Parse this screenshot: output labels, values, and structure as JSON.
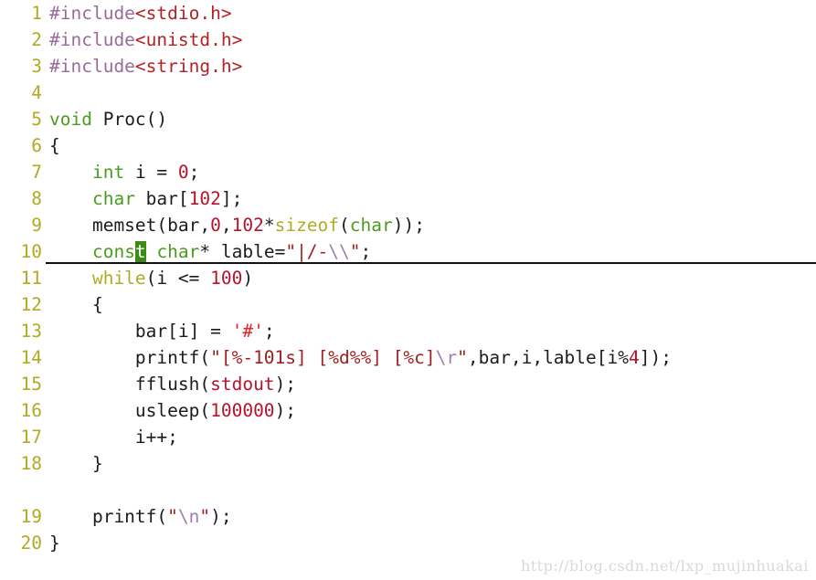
{
  "editor": {
    "language": "C",
    "background_color": "#ffffff",
    "line_height_px": 29,
    "font_size_px": 19.5,
    "active_line": 10,
    "cursor": {
      "line": 10,
      "char": "t",
      "word": "const",
      "color": "#3a8c12"
    },
    "palette": {
      "line_number": "#b0ab22",
      "preprocessor": "#9a6b9a",
      "header_name": "#b32222",
      "type_keyword": "#4a9c20",
      "control_keyword": "#b0ab22",
      "number_literal": "#b8122b",
      "string_literal": "#a02020",
      "escape_sequence": "#9b7fb0",
      "char_literal": "#e8202a",
      "plain_text": "#1c1c1c",
      "cursor_block": "#3a8c12",
      "active_line_underline": "#111111",
      "watermark": "#d9d9d9"
    }
  },
  "lines": [
    {
      "n": "1",
      "tokens": [
        {
          "t": "#include",
          "c": "pp"
        },
        {
          "t": "<stdio.h>",
          "c": "header"
        }
      ]
    },
    {
      "n": "2",
      "tokens": [
        {
          "t": "#include",
          "c": "pp"
        },
        {
          "t": "<unistd.h>",
          "c": "header"
        }
      ]
    },
    {
      "n": "3",
      "tokens": [
        {
          "t": "#include",
          "c": "pp"
        },
        {
          "t": "<string.h>",
          "c": "header"
        }
      ]
    },
    {
      "n": "4",
      "tokens": []
    },
    {
      "n": "5",
      "tokens": [
        {
          "t": "void",
          "c": "type"
        },
        {
          "t": " Proc()",
          "c": "plain"
        }
      ]
    },
    {
      "n": "6",
      "tokens": [
        {
          "t": "{",
          "c": "plain"
        }
      ]
    },
    {
      "n": "7",
      "tokens": [
        {
          "t": "    ",
          "c": "plain"
        },
        {
          "t": "int",
          "c": "type"
        },
        {
          "t": " i = ",
          "c": "plain"
        },
        {
          "t": "0",
          "c": "number"
        },
        {
          "t": ";",
          "c": "plain"
        }
      ]
    },
    {
      "n": "8",
      "tokens": [
        {
          "t": "    ",
          "c": "plain"
        },
        {
          "t": "char",
          "c": "type"
        },
        {
          "t": " bar[",
          "c": "plain"
        },
        {
          "t": "102",
          "c": "number"
        },
        {
          "t": "];",
          "c": "plain"
        }
      ]
    },
    {
      "n": "9",
      "tokens": [
        {
          "t": "    memset(bar,",
          "c": "plain"
        },
        {
          "t": "0",
          "c": "number"
        },
        {
          "t": ",",
          "c": "plain"
        },
        {
          "t": "102",
          "c": "number"
        },
        {
          "t": "*",
          "c": "plain"
        },
        {
          "t": "sizeof",
          "c": "keyword"
        },
        {
          "t": "(",
          "c": "plain"
        },
        {
          "t": "char",
          "c": "type"
        },
        {
          "t": "));",
          "c": "plain"
        }
      ]
    },
    {
      "n": "10",
      "active": true,
      "tokens": [
        {
          "t": "    ",
          "c": "plain"
        },
        {
          "t": "cons",
          "c": "type"
        },
        {
          "t": "t",
          "c": "type",
          "cursor": true
        },
        {
          "t": " ",
          "c": "plain"
        },
        {
          "t": "char",
          "c": "type"
        },
        {
          "t": "* lable=",
          "c": "plain"
        },
        {
          "t": "\"|/-",
          "c": "string"
        },
        {
          "t": "\\\\",
          "c": "escape"
        },
        {
          "t": "\"",
          "c": "string"
        },
        {
          "t": ";",
          "c": "plain"
        }
      ]
    },
    {
      "n": "11",
      "tokens": [
        {
          "t": "    ",
          "c": "plain"
        },
        {
          "t": "while",
          "c": "keyword"
        },
        {
          "t": "(i <= ",
          "c": "plain"
        },
        {
          "t": "100",
          "c": "number"
        },
        {
          "t": ")",
          "c": "plain"
        }
      ]
    },
    {
      "n": "12",
      "tokens": [
        {
          "t": "    {",
          "c": "plain"
        }
      ]
    },
    {
      "n": "13",
      "tokens": [
        {
          "t": "        bar[i] = ",
          "c": "plain"
        },
        {
          "t": "'#'",
          "c": "charlit"
        },
        {
          "t": ";",
          "c": "plain"
        }
      ]
    },
    {
      "n": "14",
      "tokens": [
        {
          "t": "        printf(",
          "c": "plain"
        },
        {
          "t": "\"[%-101s] [%d%%] [%c]",
          "c": "string"
        },
        {
          "t": "\\r",
          "c": "escape"
        },
        {
          "t": "\"",
          "c": "string"
        },
        {
          "t": ",bar,i,lable[i%",
          "c": "plain"
        },
        {
          "t": "4",
          "c": "number"
        },
        {
          "t": "]);",
          "c": "plain"
        }
      ]
    },
    {
      "n": "15",
      "tokens": [
        {
          "t": "        fflush(",
          "c": "plain"
        },
        {
          "t": "stdout",
          "c": "stdout"
        },
        {
          "t": ");",
          "c": "plain"
        }
      ]
    },
    {
      "n": "16",
      "tokens": [
        {
          "t": "        usleep(",
          "c": "plain"
        },
        {
          "t": "100000",
          "c": "number"
        },
        {
          "t": ");",
          "c": "plain"
        }
      ]
    },
    {
      "n": "17",
      "tokens": [
        {
          "t": "        i++;",
          "c": "plain"
        }
      ]
    },
    {
      "n": "18",
      "tokens": [
        {
          "t": "    }",
          "c": "plain"
        }
      ]
    },
    {
      "n": "",
      "tokens": []
    },
    {
      "n": "19",
      "tokens": [
        {
          "t": "    printf(",
          "c": "plain"
        },
        {
          "t": "\"",
          "c": "string"
        },
        {
          "t": "\\n",
          "c": "escape"
        },
        {
          "t": "\"",
          "c": "string"
        },
        {
          "t": ");",
          "c": "plain"
        }
      ]
    },
    {
      "n": "20",
      "tokens": [
        {
          "t": "}",
          "c": "plain"
        }
      ]
    }
  ],
  "watermark": {
    "text": "http://blog.csdn.net/lxp_mujinhuakai"
  }
}
